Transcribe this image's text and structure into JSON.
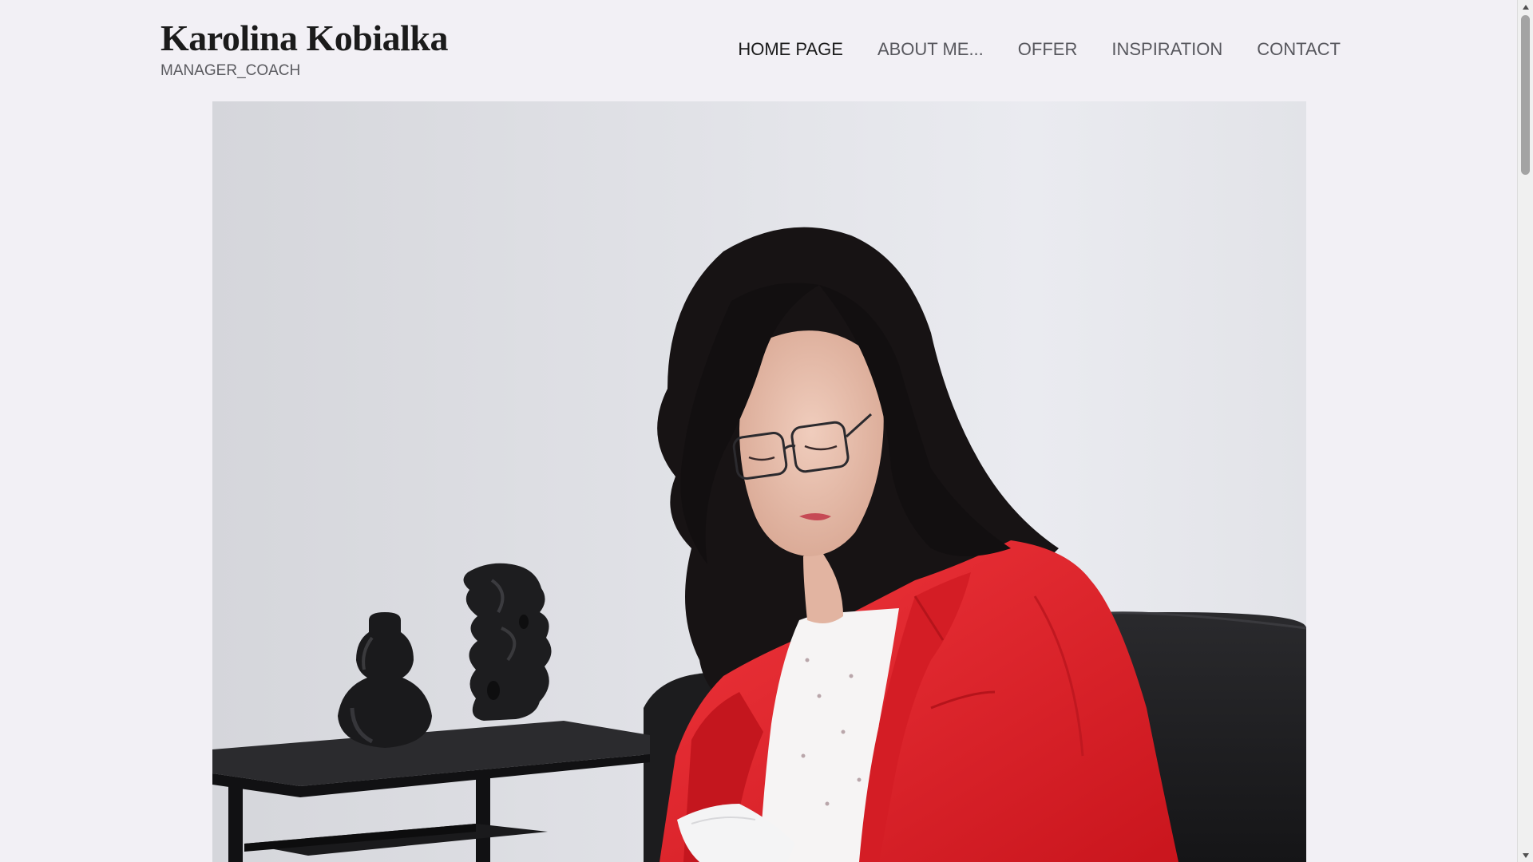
{
  "site": {
    "title": "Karolina Kobialka",
    "tagline": "MANAGER_COACH"
  },
  "nav": {
    "items": [
      {
        "label": "HOME PAGE",
        "active": true
      },
      {
        "label": "ABOUT ME...",
        "active": false
      },
      {
        "label": "OFFER",
        "active": false
      },
      {
        "label": "INSPIRATION",
        "active": false
      },
      {
        "label": "CONTACT",
        "active": false
      }
    ]
  },
  "hero": {
    "image": "portrait-photo",
    "colors": {
      "background": "#e3e4e9",
      "blazer": "#e8232b",
      "hair": "#161314",
      "furniture": "#1f1f21",
      "blouse": "#f6f4f4"
    }
  },
  "colors": {
    "page_background": "#f2f0f5",
    "text_primary": "#1b1b1b",
    "text_secondary": "#58585e"
  },
  "scrollbar": {
    "up_icon": "scroll-up-arrow-icon",
    "down_icon": "scroll-down-arrow-icon"
  }
}
